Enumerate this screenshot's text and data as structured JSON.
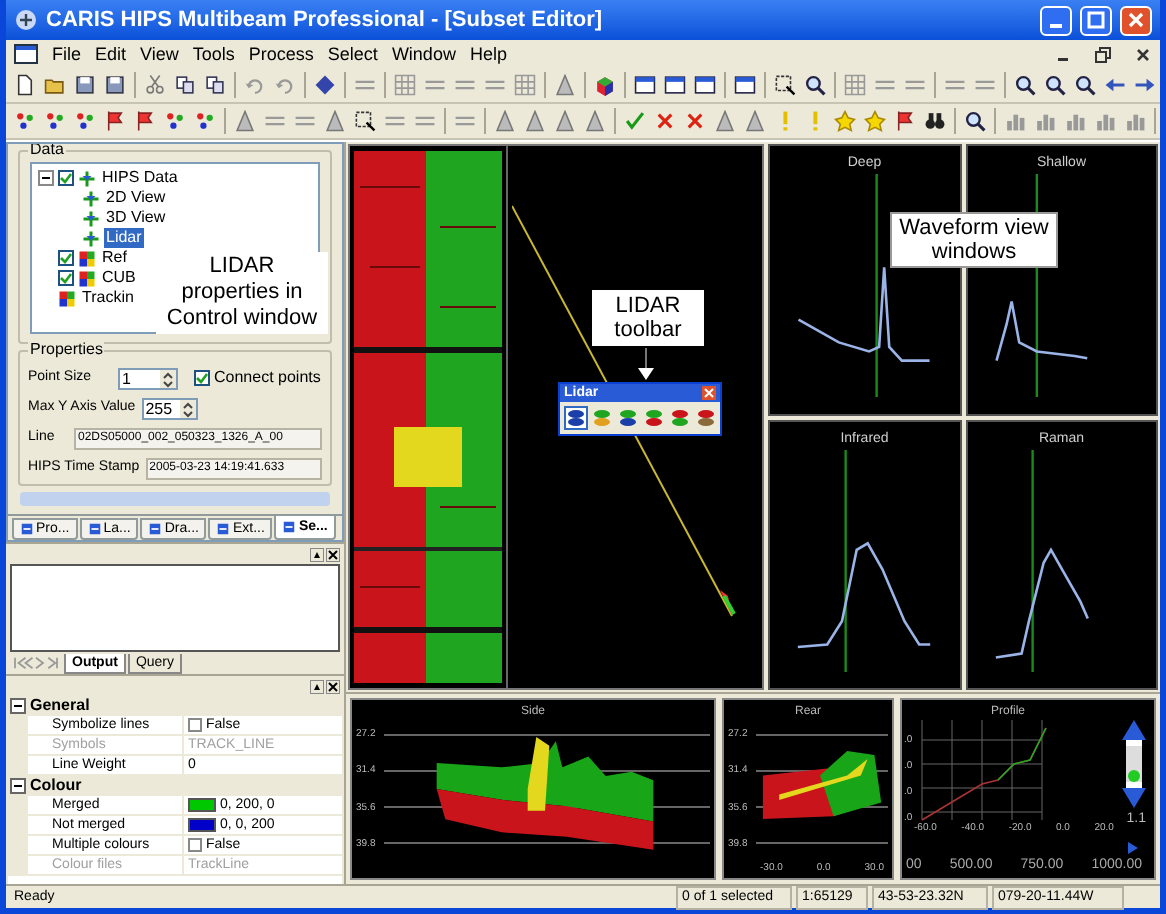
{
  "window": {
    "title": "CARIS HIPS Multibeam Professional - [Subset Editor]"
  },
  "menu": [
    "File",
    "Edit",
    "View",
    "Tools",
    "Process",
    "Select",
    "Window",
    "Help"
  ],
  "control_window": {
    "data_group": "Data",
    "tree": [
      {
        "label": "HIPS Data",
        "checked": true,
        "selected": false,
        "children": [
          {
            "label": "2D View",
            "selected": false
          },
          {
            "label": "3D View",
            "selected": false
          },
          {
            "label": "Lidar",
            "selected": true
          }
        ]
      },
      {
        "label": "Ref",
        "checked": true,
        "selected": false
      },
      {
        "label": "CUB",
        "checked": true,
        "selected": false
      },
      {
        "label": "Trackin",
        "selected": false
      }
    ],
    "properties_group": "Properties",
    "fields": [
      {
        "kind": "spin",
        "label": "Point Size",
        "value": "1"
      },
      {
        "kind": "checkbox",
        "label": "Connect points",
        "checked": true
      },
      {
        "kind": "spin",
        "label": "Max Y Axis Value",
        "value": "255"
      },
      {
        "kind": "text",
        "label": "Line",
        "value": "02DS05000_002_050323_1326_A_00"
      },
      {
        "kind": "text",
        "label": "HIPS Time Stamp",
        "value": "2005-03-23  14:19:41.633"
      }
    ],
    "tabs": [
      {
        "label": "Pro...",
        "selected": false
      },
      {
        "label": "La...",
        "selected": false
      },
      {
        "label": "Dra...",
        "selected": false
      },
      {
        "label": "Ext...",
        "selected": false
      },
      {
        "label": "Se...",
        "selected": true
      }
    ]
  },
  "output_window": {
    "tabs": [
      {
        "label": "Output",
        "selected": true
      },
      {
        "label": "Query",
        "selected": false
      }
    ]
  },
  "property_grid": [
    {
      "section": "General",
      "rows": [
        {
          "kind": "checkbox",
          "name": "Symbolize lines",
          "value": "False",
          "checked": false,
          "disabled": false
        },
        {
          "kind": "text",
          "name": "Symbols",
          "value": "TRACK_LINE",
          "disabled": true
        },
        {
          "kind": "text",
          "name": "Line Weight",
          "value": "0",
          "disabled": false
        }
      ]
    },
    {
      "section": "Colour",
      "rows": [
        {
          "kind": "color",
          "name": "Merged",
          "value": "0, 200, 0",
          "color": "#00c800",
          "disabled": false
        },
        {
          "kind": "color",
          "name": "Not merged",
          "value": "0, 0, 200",
          "color": "#0000c8",
          "disabled": false
        },
        {
          "kind": "checkbox",
          "name": "Multiple colours",
          "value": "False",
          "checked": false,
          "disabled": false
        },
        {
          "kind": "text",
          "name": "Colour files",
          "value": "TrackLine",
          "disabled": true
        }
      ]
    }
  ],
  "lidar_toolbar": {
    "title": "Lidar",
    "buttons": [
      {
        "selected": true
      },
      {
        "selected": false
      },
      {
        "selected": false
      },
      {
        "selected": false
      },
      {
        "selected": false
      },
      {
        "selected": false
      }
    ]
  },
  "callouts": [
    {
      "text": "LIDAR properties in Control window"
    },
    {
      "text": "LIDAR toolbar"
    },
    {
      "text": "Waveform view windows"
    }
  ],
  "waveforms": [
    {
      "title": "Deep"
    },
    {
      "title": "Shallow"
    },
    {
      "title": "Infrared"
    },
    {
      "title": "Raman"
    }
  ],
  "side_view": {
    "title": "Side",
    "yticks": [
      "27.2",
      "31.4",
      "35.6",
      "39.8"
    ]
  },
  "rear_view": {
    "title": "Rear",
    "yticks": [
      "27.2",
      "31.4",
      "35.6",
      "39.8"
    ],
    "xticks": [
      "-30.0",
      "0.0",
      "30.0"
    ]
  },
  "profile_view": {
    "title": "Profile",
    "yticks": [
      ".0",
      ".0",
      ".0",
      ".0"
    ],
    "xticks": [
      "-60.0",
      "-40.0",
      "-20.0",
      "0.0",
      "20.0"
    ],
    "scale": [
      "00",
      "500.00",
      "750.00",
      "1000.00"
    ],
    "slider_value": "1.1",
    "zoom_slider": {
      "level": 0.17
    }
  },
  "status_bar": [
    "Ready",
    "0 of 1 selected",
    "1:65129",
    "43-53-23.32N",
    "079-20-11.44W"
  ]
}
